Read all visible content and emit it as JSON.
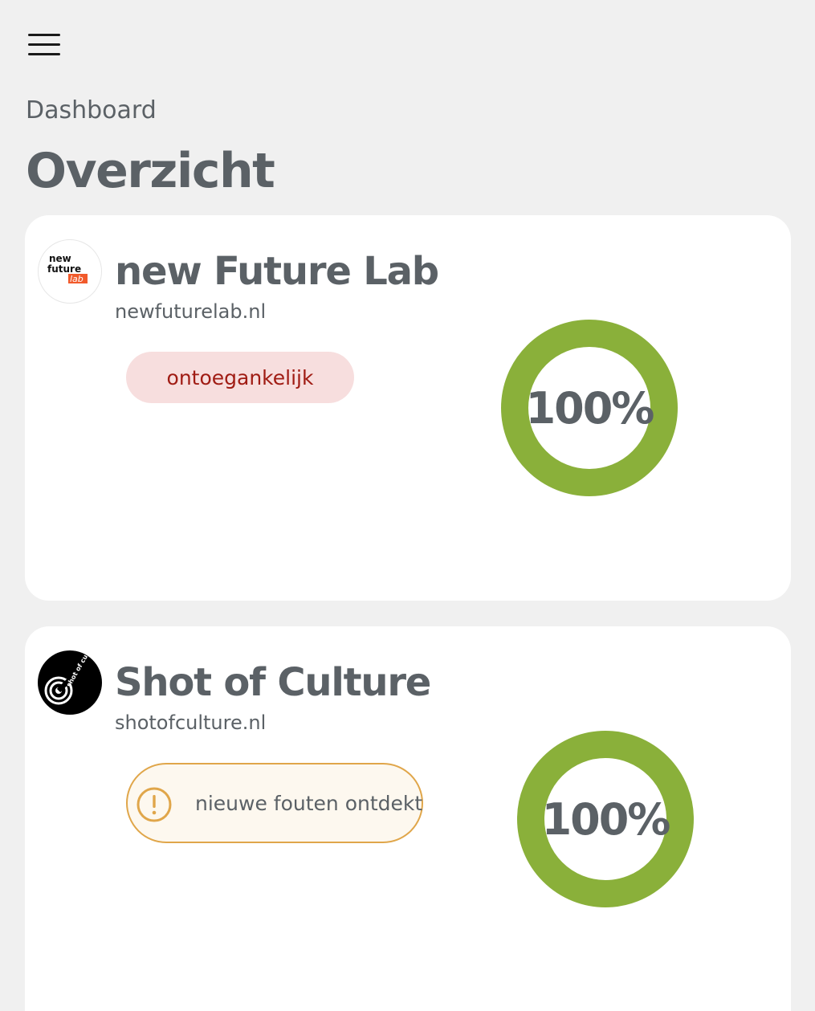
{
  "header": {
    "menu_icon": "hamburger-menu-icon"
  },
  "breadcrumb": "Dashboard",
  "page_title": "Overzicht",
  "colors": {
    "background": "#f0f0f0",
    "card": "#ffffff",
    "text": "#5b6166",
    "ring_green": "#8ab03a",
    "badge_red_bg": "#f7dede",
    "badge_red_text": "#a01c14",
    "badge_warn_border": "#e0a64a",
    "badge_warn_bg": "#fdf8ef"
  },
  "sites": [
    {
      "name": "new Future Lab",
      "url": "newfuturelab.nl",
      "logo": {
        "line1": "new",
        "line2": "future",
        "line3": "lab"
      },
      "status": "ontoegankelijk",
      "score": "100%",
      "score_fraction": 1.0
    },
    {
      "name": "Shot of Culture",
      "url": "shotofculture.nl",
      "logo": {
        "text": "shot of culture"
      },
      "status": "nieuwe fouten ontdekt",
      "status_icon": "warning-exclamation-icon",
      "score": "100%",
      "score_fraction": 1.0
    }
  ]
}
